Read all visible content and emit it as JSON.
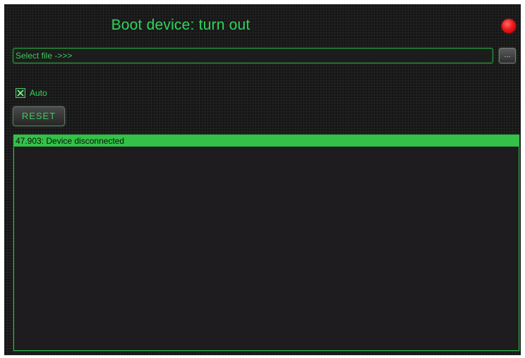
{
  "window": {
    "title": "Boot device: turn out",
    "status_color": "#f01a1a"
  },
  "file_select": {
    "placeholder": "Select file ->>>",
    "value": "",
    "browse_label": "..."
  },
  "auto": {
    "label": "Auto",
    "checked": true
  },
  "reset": {
    "label": "RESET"
  },
  "log": {
    "entries": [
      {
        "time": "47.903",
        "message": "Device disconnected",
        "text": "47.903: Device disconnected",
        "selected": true
      }
    ]
  },
  "colors": {
    "accent_green": "#2fd55b",
    "selection_green": "#33c247",
    "background": "#161616"
  }
}
